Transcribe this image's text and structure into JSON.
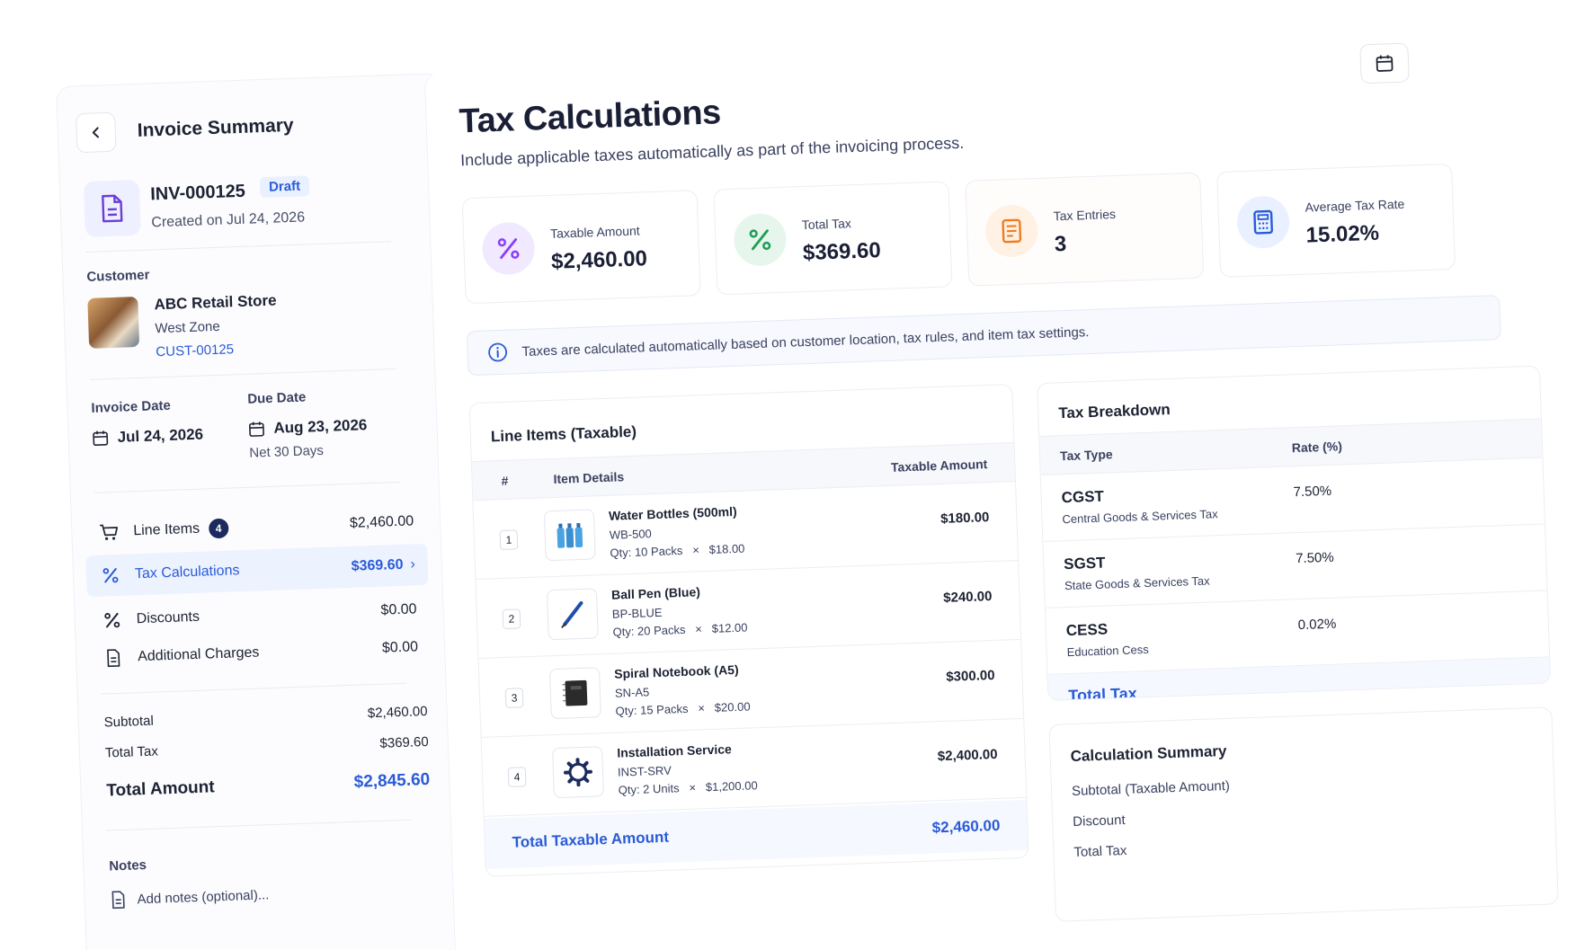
{
  "sidebar": {
    "title": "Invoice Summary",
    "invoice_number": "INV-000125",
    "status": "Draft",
    "created": "Created on Jul 24, 2026",
    "customer_label": "Customer",
    "customer": {
      "name": "ABC Retail Store",
      "zone": "West Zone",
      "id": "CUST-00125"
    },
    "invoice_date_label": "Invoice Date",
    "invoice_date": "Jul 24, 2026",
    "due_date_label": "Due Date",
    "due_date": "Aug 23, 2026",
    "terms": "Net 30 Days",
    "nav": [
      {
        "label": "Line Items",
        "badge": "4",
        "amount": "$2,460.00",
        "icon": "cart-icon"
      },
      {
        "label": "Tax Calculations",
        "amount": "$369.60",
        "icon": "percent-icon",
        "active": true
      },
      {
        "label": "Discounts",
        "amount": "$0.00",
        "icon": "percent-icon"
      },
      {
        "label": "Additional Charges",
        "amount": "$0.00",
        "icon": "document-icon"
      }
    ],
    "subtotal_label": "Subtotal",
    "subtotal": "$2,460.00",
    "total_tax_label": "Total Tax",
    "total_tax": "$369.60",
    "total_amount_label": "Total Amount",
    "total_amount": "$2,845.60",
    "notes_label": "Notes",
    "notes_placeholder": "Add notes (optional)..."
  },
  "main": {
    "title": "Tax Calculations",
    "subtitle": "Include applicable taxes automatically as part of the invoicing process.",
    "stats": [
      {
        "label": "Taxable Amount",
        "value": "$2,460.00",
        "icon": "percent-icon",
        "color": "#8b3dff",
        "bg": "#f1e9ff"
      },
      {
        "label": "Total Tax",
        "value": "$369.60",
        "icon": "percent-icon",
        "color": "#1f9d55",
        "bg": "#e6f6ec"
      },
      {
        "label": "Tax Entries",
        "value": "3",
        "icon": "receipt-icon",
        "color": "#f07c1f",
        "bg": "#fff1e4"
      },
      {
        "label": "Average Tax Rate",
        "value": "15.02%",
        "icon": "calculator-icon",
        "color": "#2a5bd7",
        "bg": "#e9f0ff"
      }
    ],
    "info_text": "Taxes are calculated automatically based on customer location, tax rules, and item tax settings.",
    "line_items": {
      "title": "Line Items (Taxable)",
      "col_num": "#",
      "col_item": "Item Details",
      "col_amount": "Taxable Amount",
      "rows": [
        {
          "n": "1",
          "name": "Water Bottles (500ml)",
          "sku": "WB-500",
          "qty": "Qty: 10 Packs",
          "x": "×",
          "price": "$18.00",
          "amount": "$180.00",
          "icon": "bottles-icon"
        },
        {
          "n": "2",
          "name": "Ball Pen (Blue)",
          "sku": "BP-BLUE",
          "qty": "Qty: 20 Packs",
          "x": "×",
          "price": "$12.00",
          "amount": "$240.00",
          "icon": "pen-icon"
        },
        {
          "n": "3",
          "name": "Spiral Notebook (A5)",
          "sku": "SN-A5",
          "qty": "Qty: 15 Packs",
          "x": "×",
          "price": "$20.00",
          "amount": "$300.00",
          "icon": "notebook-icon"
        },
        {
          "n": "4",
          "name": "Installation Service",
          "sku": "INST-SRV",
          "qty": "Qty: 2 Units",
          "x": "×",
          "price": "$1,200.00",
          "amount": "$2,400.00",
          "icon": "gear-icon"
        }
      ],
      "total_label": "Total Taxable Amount",
      "total": "$2,460.00"
    },
    "breakdown": {
      "title": "Tax Breakdown",
      "col_type": "Tax Type",
      "col_rate": "Rate (%)",
      "rows": [
        {
          "name": "CGST",
          "desc": "Central Goods & Services Tax",
          "rate": "7.50%"
        },
        {
          "name": "SGST",
          "desc": "State Goods & Services Tax",
          "rate": "7.50%"
        },
        {
          "name": "CESS",
          "desc": "Education Cess",
          "rate": "0.02%"
        }
      ],
      "total_label": "Total Tax"
    },
    "calc_summary": {
      "title": "Calculation Summary",
      "rows": [
        "Subtotal (Taxable Amount)",
        "Discount",
        "Total Tax"
      ]
    }
  }
}
